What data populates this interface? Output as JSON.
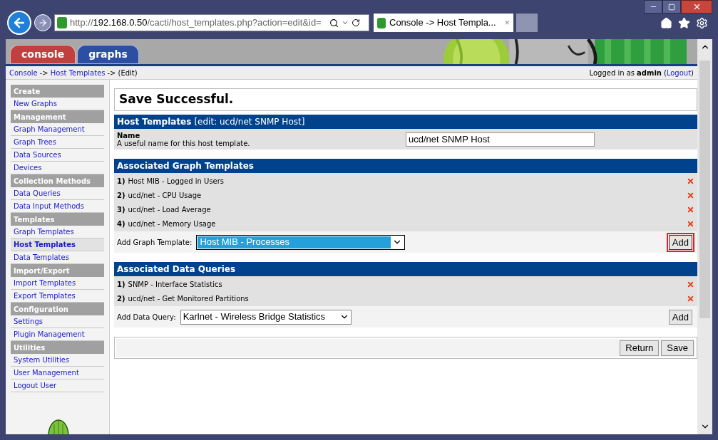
{
  "browser": {
    "url_prefix": "http://",
    "url_host": "192.168.0.50",
    "url_rest": "/cacti/host_templates.php?action=edit&id=",
    "tab_title": "Console -> Host Templa...",
    "tab_close": "×"
  },
  "nav_tabs": [
    {
      "label": "console",
      "color": "#c0403f"
    },
    {
      "label": "graphs",
      "color": "#2c4fa3"
    }
  ],
  "breadcrumb": [
    {
      "kind": "link",
      "text": "Console"
    },
    {
      "kind": "text",
      "text": "->"
    },
    {
      "kind": "link",
      "text": "Host Templates"
    },
    {
      "kind": "text",
      "text": "->"
    },
    {
      "kind": "text",
      "text": "(Edit)"
    }
  ],
  "login": {
    "prefix": "Logged in as",
    "user": "admin",
    "open": "(",
    "logout": "Logout",
    "close": ")"
  },
  "sidebar": [
    {
      "title": "Create",
      "items": [
        {
          "label": "New Graphs",
          "selected": false
        }
      ]
    },
    {
      "title": "Management",
      "items": [
        {
          "label": "Graph Management",
          "selected": false
        },
        {
          "label": "Graph Trees",
          "selected": false
        },
        {
          "label": "Data Sources",
          "selected": false
        },
        {
          "label": "Devices",
          "selected": false
        }
      ]
    },
    {
      "title": "Collection Methods",
      "items": [
        {
          "label": "Data Queries",
          "selected": false
        },
        {
          "label": "Data Input Methods",
          "selected": false
        }
      ]
    },
    {
      "title": "Templates",
      "items": [
        {
          "label": "Graph Templates",
          "selected": false
        },
        {
          "label": "Host Templates",
          "selected": true
        },
        {
          "label": "Data Templates",
          "selected": false
        }
      ]
    },
    {
      "title": "Import/Export",
      "items": [
        {
          "label": "Import Templates",
          "selected": false
        },
        {
          "label": "Export Templates",
          "selected": false
        }
      ]
    },
    {
      "title": "Configuration",
      "items": [
        {
          "label": "Settings",
          "selected": false
        },
        {
          "label": "Plugin Management",
          "selected": false
        }
      ]
    },
    {
      "title": "Utilities",
      "items": [
        {
          "label": "System Utilities",
          "selected": false
        },
        {
          "label": "User Management",
          "selected": false
        },
        {
          "label": "Logout User",
          "selected": false
        }
      ]
    }
  ],
  "message": "Save Successful.",
  "host_panel": {
    "title": "Host Templates",
    "subtitle": "[edit: ucd/net SNMP Host]",
    "field_label": "Name",
    "field_hint": "A useful name for this host template.",
    "value": "ucd/net SNMP Host"
  },
  "sections": [
    {
      "title": "Associated Graph Templates",
      "items": [
        {
          "num": "1)",
          "label": "Host MIB - Logged in Users"
        },
        {
          "num": "2)",
          "label": "ucd/net - CPU Usage"
        },
        {
          "num": "3)",
          "label": "ucd/net - Load Average"
        },
        {
          "num": "4)",
          "label": "ucd/net - Memory Usage"
        }
      ],
      "add_label": "Add Graph Template:",
      "select_value": "Host MIB - Processes",
      "select_focused": true,
      "button": "Add",
      "highlighted": true
    },
    {
      "title": "Associated Data Queries",
      "items": [
        {
          "num": "1)",
          "label": "SNMP - Interface Statistics"
        },
        {
          "num": "2)",
          "label": "ucd/net - Get Monitored Partitions"
        }
      ],
      "add_label": "Add Data Query:",
      "select_value": "Karlnet - Wireless Bridge Statistics",
      "select_focused": false,
      "button": "Add",
      "highlighted": false
    }
  ],
  "actions": [
    "Return",
    "Save"
  ]
}
